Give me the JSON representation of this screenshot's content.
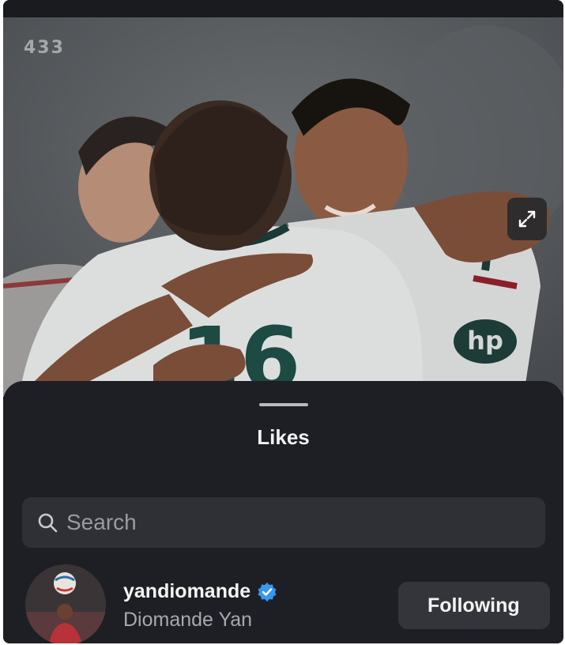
{
  "photo": {
    "watermark": "433",
    "jersey_number": "16",
    "sponsor_mark": "hp"
  },
  "sheet": {
    "title": "Likes"
  },
  "search": {
    "placeholder": "Search",
    "icon": "search-icon"
  },
  "likes": [
    {
      "username": "yandiomande",
      "verified": true,
      "full_name": "Diomande Yan",
      "button_label": "Following"
    }
  ],
  "colors": {
    "sheet_background": "#1e1f24",
    "search_background": "#2f3036",
    "button_background": "#34353b",
    "verified_badge": "#3897f0",
    "primary_text": "#f4f4f4",
    "secondary_text": "#a8a9ae"
  },
  "icons": {
    "verified": "verified-badge-icon",
    "expand": "expand-icon"
  }
}
